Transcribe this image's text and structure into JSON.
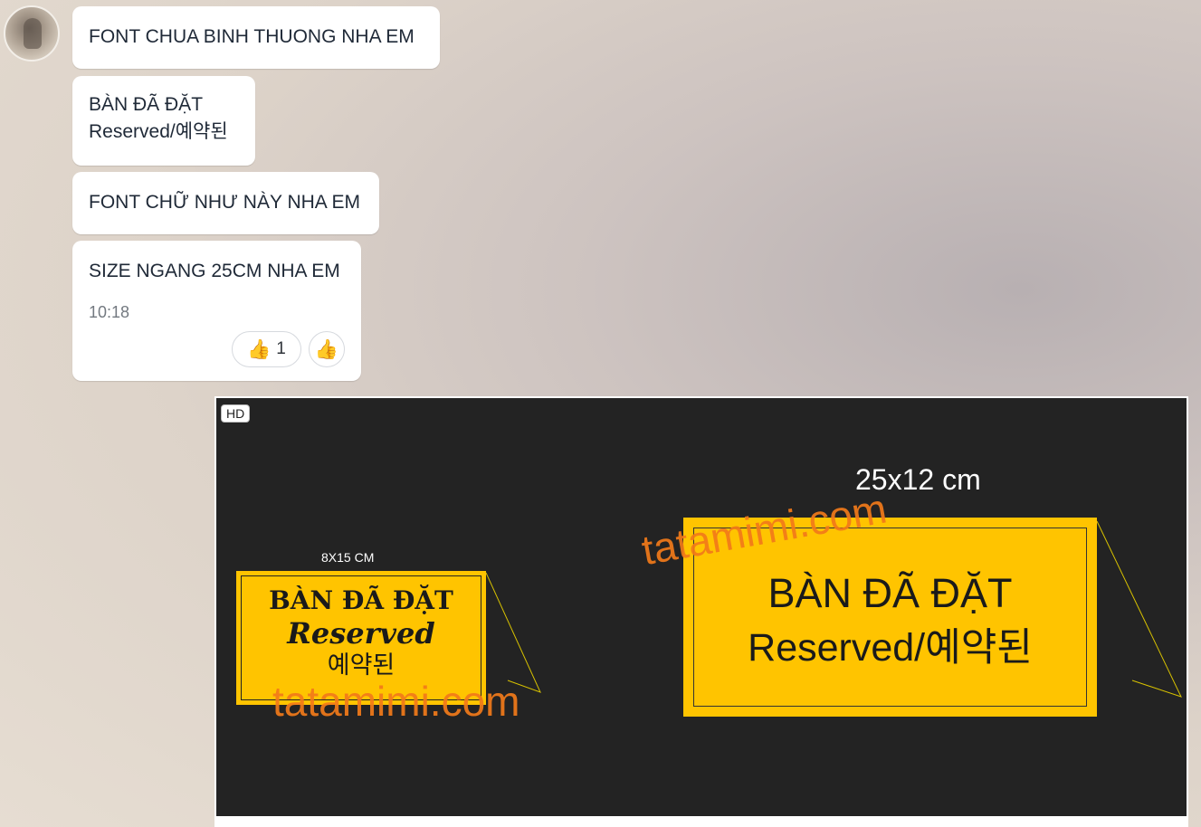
{
  "messages": [
    {
      "text": "FONT CHUA BINH THUONG NHA EM"
    },
    {
      "lines": [
        "BÀN ĐÃ ĐẶT",
        "Reserved/예약된"
      ]
    },
    {
      "text": "FONT CHỮ NHƯ NÀY NHA EM"
    },
    {
      "text": "SIZE NGANG 25CM NHA EM",
      "time": "10:18",
      "reaction_count": "1"
    }
  ],
  "photo": {
    "badge": "HD",
    "small_sign": {
      "size_label": "8X15 CM",
      "line1": "BÀN ĐÃ ĐẶT",
      "line2": "Reserved",
      "line3": "예약된"
    },
    "big_sign": {
      "size_label": "25x12 cm",
      "line1": "BÀN ĐÃ ĐẶT",
      "line2": "Reserved/예약된"
    },
    "watermark": "tatamimi.com",
    "sign_color": "#ffc400",
    "watermark_color": "#f27a1a"
  },
  "icons": {
    "reaction": "thumbs-up-icon"
  }
}
